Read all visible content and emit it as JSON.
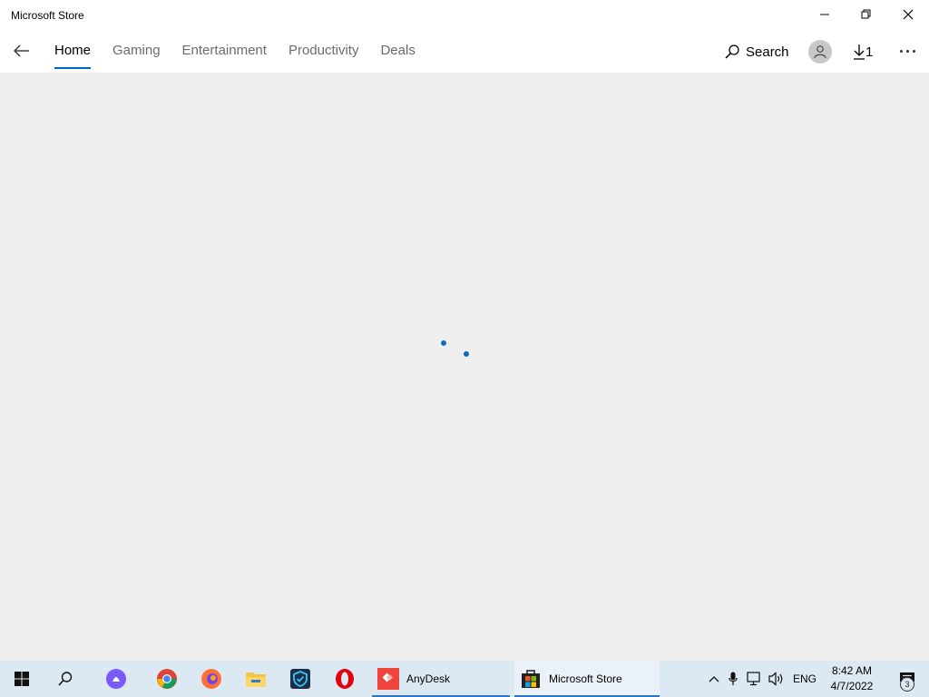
{
  "window": {
    "title": "Microsoft Store"
  },
  "nav": {
    "tabs": [
      {
        "label": "Home",
        "active": true
      },
      {
        "label": "Gaming",
        "active": false
      },
      {
        "label": "Entertainment",
        "active": false
      },
      {
        "label": "Productivity",
        "active": false
      },
      {
        "label": "Deals",
        "active": false
      }
    ],
    "search_label": "Search",
    "downloads_count": "1"
  },
  "content": {
    "state": "loading"
  },
  "taskbar": {
    "apps": [
      {
        "label": "AnyDesk",
        "icon": "anydesk-icon",
        "active": false
      },
      {
        "label": "Microsoft Store",
        "icon": "microsoft-store-icon",
        "active": true
      }
    ],
    "pinned_icons": [
      "start-icon",
      "search-icon",
      "cortana-icon",
      "chrome-icon",
      "firefox-icon",
      "file-explorer-icon",
      "security-shield-icon",
      "opera-icon"
    ],
    "tray": {
      "language": "ENG",
      "notification_count": "3"
    },
    "clock": {
      "time": "8:42 AM",
      "date": "4/7/2022"
    }
  },
  "colors": {
    "accent": "#0067c0",
    "spinner": "#0f6cbd",
    "taskbar": "#dde9f2"
  }
}
